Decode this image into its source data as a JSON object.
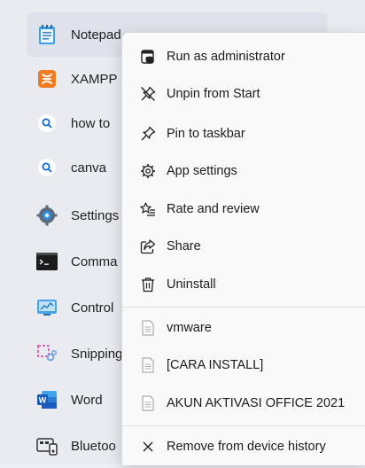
{
  "start_menu": {
    "apps": [
      {
        "label": "Notepad",
        "icon": "notepad-icon",
        "selected": true
      },
      {
        "label": "XAMPP",
        "icon": "xampp-icon"
      },
      {
        "label": "how to",
        "icon": "search-icon"
      },
      {
        "label": "canva",
        "icon": "search-icon"
      },
      {
        "label": "Settings",
        "icon": "settings-gear-icon"
      },
      {
        "label": "Comma",
        "icon": "command-prompt-icon"
      },
      {
        "label": "Control",
        "icon": "control-panel-icon"
      },
      {
        "label": "Snipping",
        "icon": "snipping-tool-icon"
      },
      {
        "label": "Word",
        "icon": "word-icon"
      },
      {
        "label": "Bluetoo",
        "icon": "bluetooth-file-transfer-icon"
      }
    ]
  },
  "context_menu": {
    "items": [
      {
        "label": "Run as administrator",
        "icon": "admin-shield-icon"
      },
      {
        "label": "Unpin from Start",
        "icon": "unpin-icon"
      },
      {
        "label": "Pin to taskbar",
        "icon": "pin-icon"
      },
      {
        "label": "App settings",
        "icon": "gear-icon"
      },
      {
        "label": "Rate and review",
        "icon": "star-list-icon"
      },
      {
        "label": "Share",
        "icon": "share-icon"
      },
      {
        "label": "Uninstall",
        "icon": "trash-icon"
      }
    ],
    "recent_files": [
      {
        "label": "vmware",
        "icon": "document-icon"
      },
      {
        "label": "[CARA INSTALL]",
        "icon": "document-icon"
      },
      {
        "label": "AKUN AKTIVASI OFFICE 2021",
        "icon": "document-icon"
      }
    ],
    "footer_item": {
      "label": "Remove from device history",
      "icon": "close-icon"
    }
  },
  "colors": {
    "menu_background": "#f9f9f9",
    "list_background": "#e9ebf1",
    "word_blue": "#185abd",
    "xampp_orange": "#f37a1f",
    "search_blue": "#0a6cd8"
  }
}
